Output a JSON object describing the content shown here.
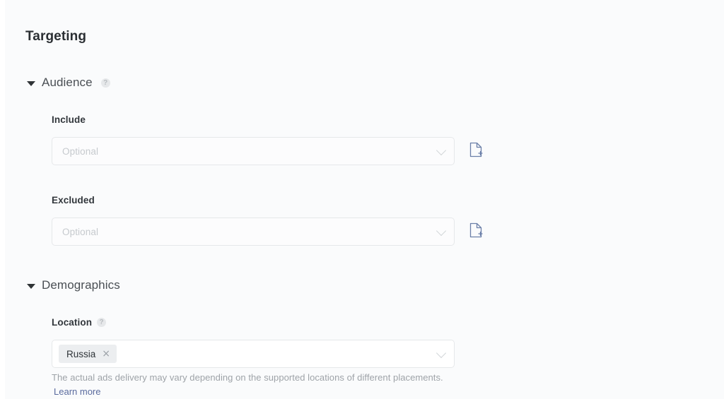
{
  "page": {
    "title": "Targeting"
  },
  "sections": [
    {
      "id": "audience",
      "title": "Audience",
      "help_icon": "help-circle-icon",
      "caret_icon": "caret-down-icon",
      "expanded": true
    },
    {
      "id": "demographics",
      "title": "Demographics",
      "caret_icon": "caret-down-icon",
      "expanded": true
    }
  ],
  "fields": {
    "include": {
      "label": "Include",
      "placeholder": "Optional",
      "value": "",
      "chevron_icon": "chevron-down-icon",
      "upload_icon": "file-add-icon"
    },
    "excluded": {
      "label": "Excluded",
      "placeholder": "Optional",
      "value": "",
      "chevron_icon": "chevron-down-icon",
      "upload_icon": "file-add-icon"
    },
    "location": {
      "label": "Location",
      "help_icon": "help-circle-icon",
      "chevron_icon": "chevron-down-icon",
      "chips": [
        {
          "label": "Russia",
          "remove_icon": "close-icon",
          "remove_glyph": "×"
        }
      ],
      "helper_text": "The actual ads delivery may vary depending on the supported locations of different placements.",
      "learn_more_label": "Learn more"
    }
  },
  "glyphs": {
    "help": "?"
  },
  "colors": {
    "background": "#fafbfc",
    "title_text": "#2b2f33",
    "label_text": "#31363b",
    "placeholder_text": "#c6cace",
    "border": "#e6e8ea",
    "chip_background": "#eceef0",
    "link": "#5a6b9e",
    "icon_blue": "#6b7fa8",
    "helper_text": "#9ea3a8"
  }
}
